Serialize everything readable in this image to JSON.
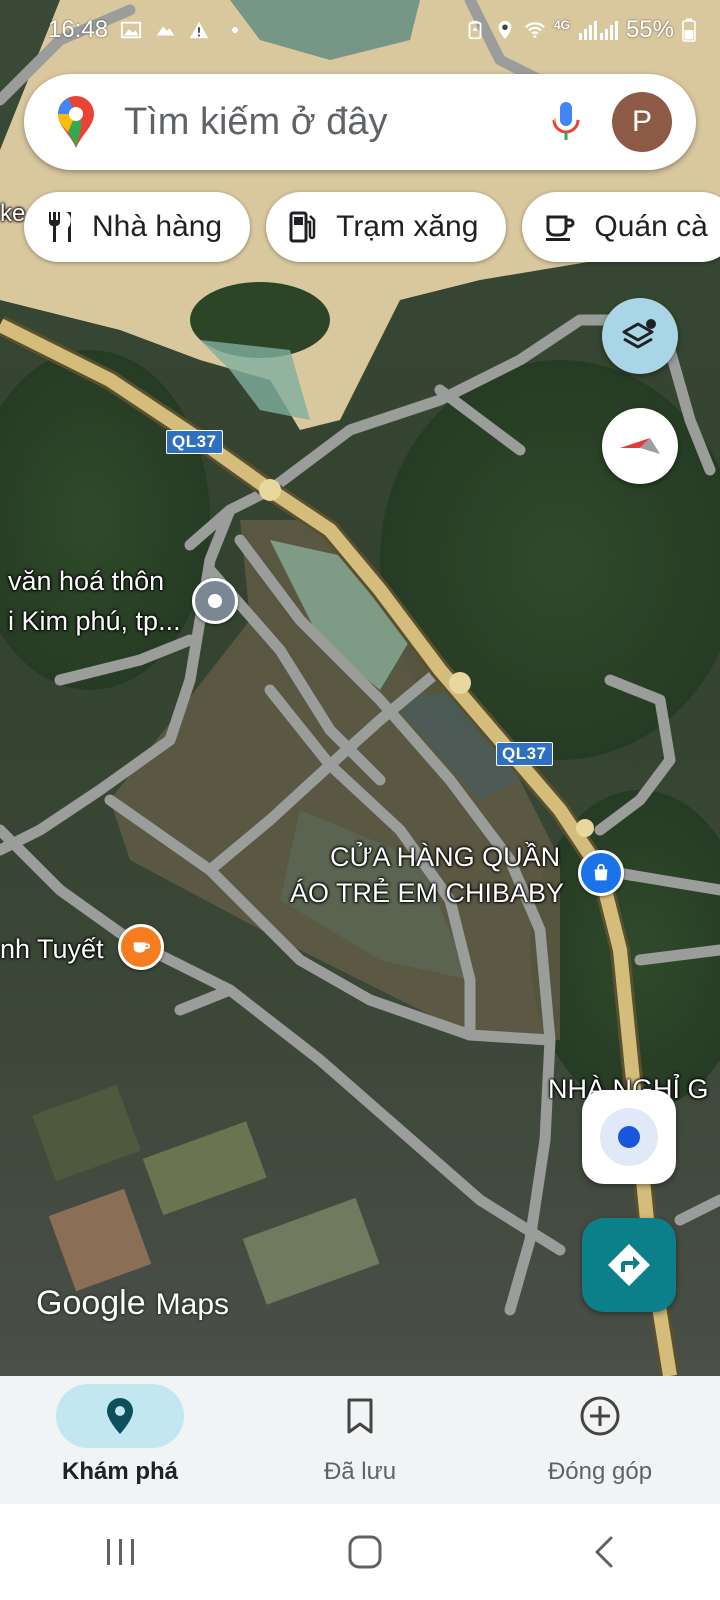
{
  "status_bar": {
    "time": "16:48",
    "battery": "55%",
    "network": "4G",
    "left_icons": [
      "gallery-icon",
      "cloud-icon",
      "warning-icon",
      "dot-icon"
    ],
    "right_icons": [
      "battery-saver-icon",
      "location-icon",
      "wifi-icon",
      "signal-icon",
      "battery-icon"
    ]
  },
  "search": {
    "placeholder": "Tìm kiếm ở đây",
    "avatar_letter": "P",
    "icons": [
      "google-maps-logo-icon",
      "microphone-icon"
    ]
  },
  "chips": [
    {
      "label": "Nhà hàng",
      "icon": "restaurant-icon"
    },
    {
      "label": "Trạm xăng",
      "icon": "gas-station-icon"
    },
    {
      "label": "Quán cà",
      "icon": "coffee-icon"
    }
  ],
  "map": {
    "route_shields": [
      "QL37",
      "QL37"
    ],
    "labels": {
      "partial_left": "ke",
      "cultural_house_line1": "văn hoá thôn",
      "cultural_house_line2": "i Kim phú, tp...",
      "clothing_store_line1": "CỬA HÀNG QUẦN",
      "clothing_store_line2": "ÁO TRẺ EM CHIBABY",
      "cafe": "nh Tuyết",
      "guesthouse": "NHÀ NGHỈ G"
    },
    "attribution": {
      "google": "Google",
      "maps": "Maps"
    },
    "colors": {
      "highway": "#d4bd7a",
      "road": "#9b9d9b",
      "water": "#7fae9e",
      "sand": "#d9c79e",
      "cafe_pin": "#f57c1f",
      "store_pin": "#1a73e8"
    }
  },
  "controls": {
    "layers_icon": "layers-icon",
    "compass_icon": "compass-icon",
    "location_icon": "my-location-icon",
    "directions_icon": "directions-icon",
    "directions_color": "#0b7f8a"
  },
  "bottom_nav": [
    {
      "label": "Khám phá",
      "icon": "explore-pin-icon",
      "active": true
    },
    {
      "label": "Đã lưu",
      "icon": "bookmark-icon",
      "active": false
    },
    {
      "label": "Đóng góp",
      "icon": "add-circle-icon",
      "active": false
    }
  ],
  "system_nav": [
    "recent-apps-icon",
    "home-icon",
    "back-icon"
  ]
}
